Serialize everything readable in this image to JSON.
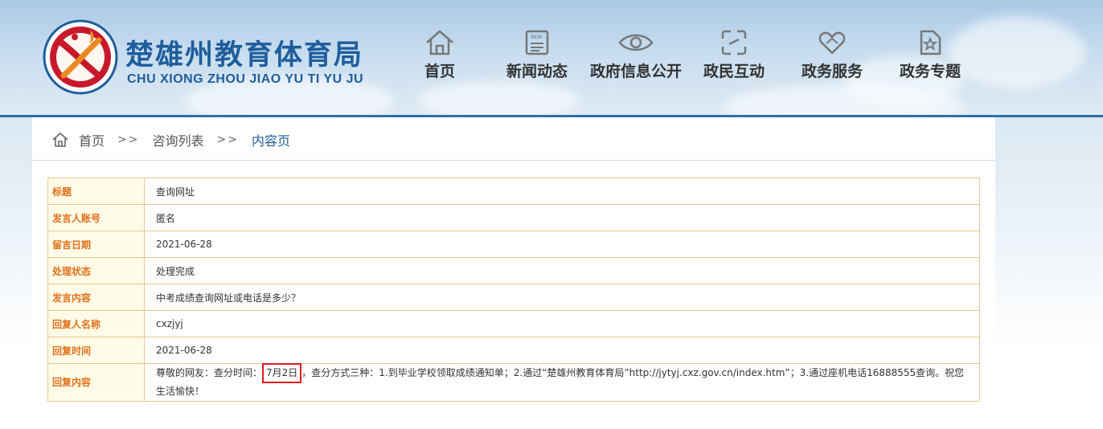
{
  "site": {
    "title": "楚雄州教育体育局",
    "subtitle": "CHU XIONG ZHOU JIAO YU TI YU JU"
  },
  "nav": [
    {
      "label": "首页",
      "icon": "home-icon"
    },
    {
      "label": "新闻动态",
      "icon": "newspaper-icon"
    },
    {
      "label": "政府信息公开",
      "icon": "eye-icon"
    },
    {
      "label": "政民互动",
      "icon": "interaction-icon"
    },
    {
      "label": "政务服务",
      "icon": "handshake-icon"
    },
    {
      "label": "政务专题",
      "icon": "star-document-icon"
    }
  ],
  "breadcrumb": {
    "home": "首页",
    "sep1": ">>",
    "list": "咨询列表",
    "sep2": ">>",
    "current": "内容页"
  },
  "detail": {
    "rows": [
      {
        "key": "标题",
        "value": "查询网址"
      },
      {
        "key": "发言人账号",
        "value": "匿名"
      },
      {
        "key": "留言日期",
        "value": "2021-06-28"
      },
      {
        "key": "处理状态",
        "value": "处理完成"
      },
      {
        "key": "发言内容",
        "value": "中考成绩查询网址或电话是多少？"
      },
      {
        "key": "回复人名称",
        "value": "cxzjyj"
      },
      {
        "key": "回复时间",
        "value": "2021-06-28"
      }
    ],
    "reply": {
      "key": "回复内容",
      "before": "尊敬的网友：查分时间：",
      "highlight": "7月2日",
      "after": "，查分方式三种：1.到毕业学校领取成绩通知单；2.通过“楚雄州教育体育局”http://jytyj.cxz.gov.cn/index.htm”；3.通过座机电话16888555查询。祝您生活愉快！"
    }
  },
  "colors": {
    "brand_blue": "#1f5d9c",
    "key_orange": "#e0701a",
    "border_tan": "#e6c993",
    "highlight_red": "#e0191f"
  }
}
